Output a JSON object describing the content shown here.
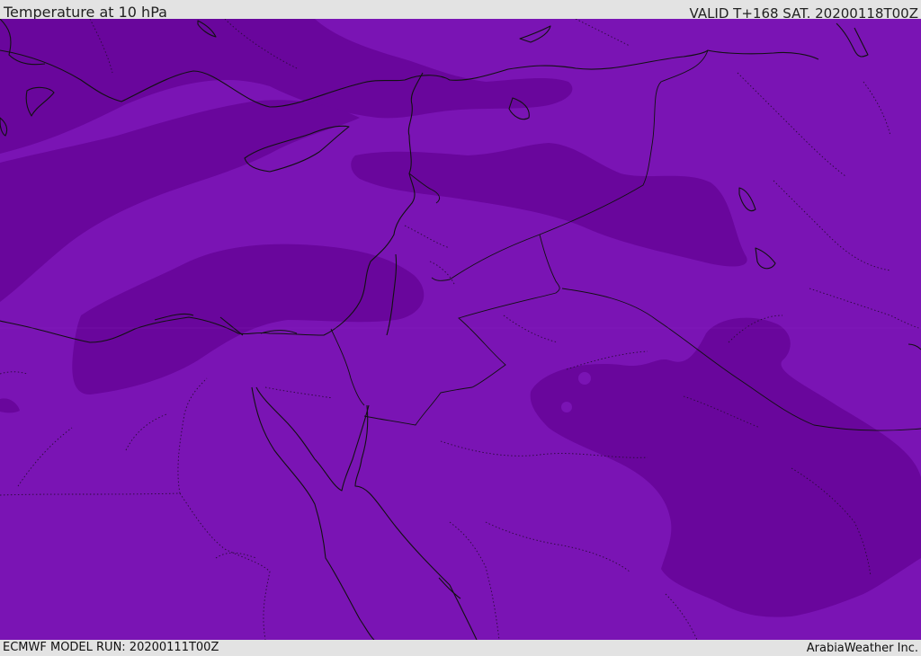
{
  "header": {
    "title": "Temperature at 10 hPa",
    "valid": "VALID T+168 SAT. 20200118T00Z"
  },
  "footer": {
    "model_run": "ECMWF MODEL RUN: 20200111T00Z",
    "brand": "ArabiaWeather Inc."
  },
  "map": {
    "colors": {
      "base": "#7a14b4",
      "dark": "#69069c",
      "coast": "#111111",
      "border": "#1a0a24"
    }
  }
}
